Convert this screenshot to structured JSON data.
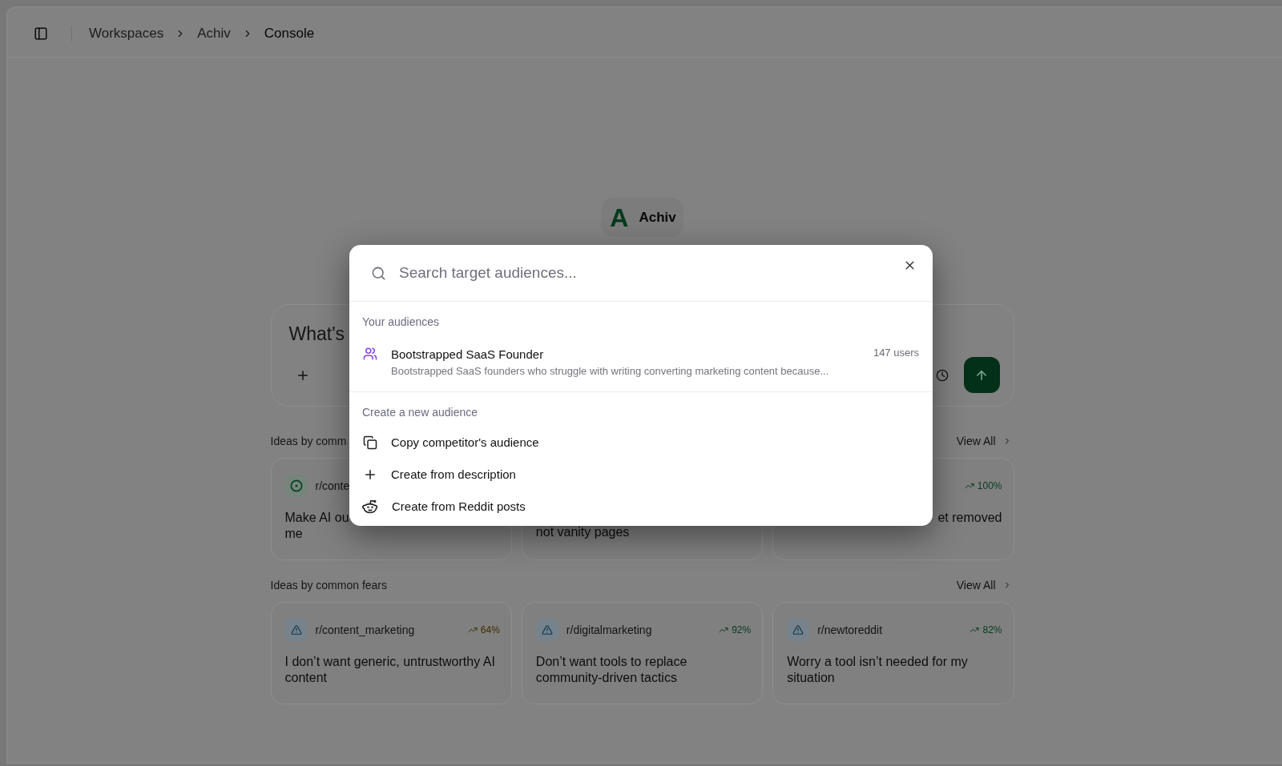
{
  "header": {
    "breadcrumbs": [
      {
        "label": "Workspaces",
        "current": false
      },
      {
        "label": "Achiv",
        "current": false
      },
      {
        "label": "Console",
        "current": true
      }
    ]
  },
  "brand": {
    "logo_letter": "A",
    "name": "Achiv"
  },
  "composer": {
    "placeholder": "What's"
  },
  "sections": [
    {
      "title": "Ideas by comm",
      "view_all": "View All",
      "cards": [
        {
          "tag": {
            "kind": "goal",
            "subreddit": "r/conte"
          },
          "lines": [
            "Make AI ou",
            "me"
          ]
        },
        {
          "lines": [
            "not vanity pages"
          ]
        },
        {
          "trend": {
            "value": "100%",
            "color": "#053a1f"
          },
          "lines": [
            "et removed"
          ]
        }
      ]
    },
    {
      "title": "Ideas by common fears",
      "view_all": "View All",
      "cards": [
        {
          "tag": {
            "kind": "fear",
            "subreddit": "r/content_marketing"
          },
          "trend": {
            "value": "64%",
            "color": "#3d2c00"
          },
          "text": "I don’t want generic, untrustworthy AI content"
        },
        {
          "tag": {
            "kind": "fear",
            "subreddit": "r/digitalmarketing"
          },
          "trend": {
            "value": "92%",
            "color": "#053a1f"
          },
          "text": "Don’t want tools to replace community-driven tactics"
        },
        {
          "tag": {
            "kind": "fear",
            "subreddit": "r/newtoreddit"
          },
          "trend": {
            "value": "82%",
            "color": "#053a1f"
          },
          "text": "Worry a tool isn’t needed for my situation"
        }
      ]
    }
  ],
  "audience_picker": {
    "search": {
      "placeholder": "Search target audiences..."
    },
    "groups": [
      {
        "title": "Your audiences",
        "items": [
          {
            "kind": "audience",
            "name": "Bootstrapped SaaS Founder",
            "description": "Bootstrapped SaaS founders who struggle with writing converting marketing content because...",
            "count": "147 users"
          }
        ]
      },
      {
        "title": "Create a new audience",
        "items": [
          {
            "kind": "copy",
            "label": "Copy competitor's audience"
          },
          {
            "kind": "plus",
            "label": "Create from description"
          },
          {
            "kind": "reddit",
            "label": "Create from Reddit posts"
          }
        ]
      }
    ]
  }
}
